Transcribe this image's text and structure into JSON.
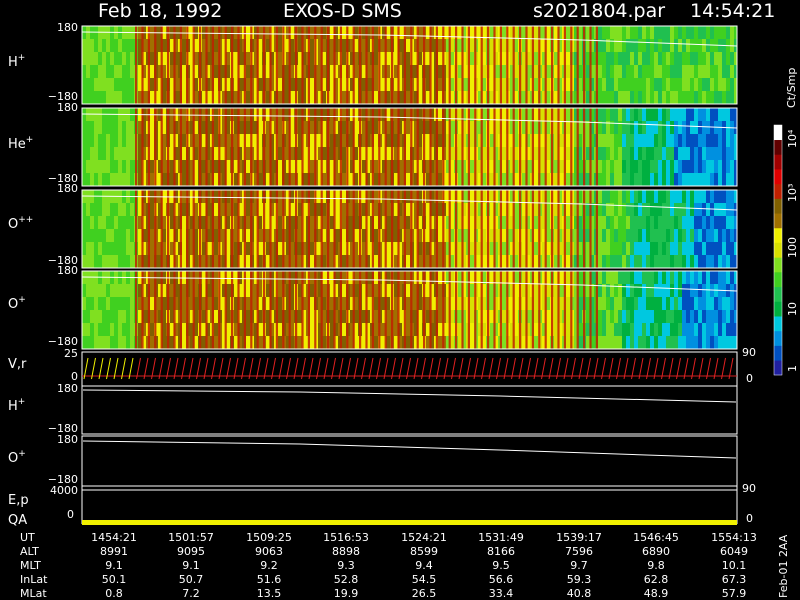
{
  "header": {
    "date": "Feb 18, 1992",
    "mission": "EXOS-D SMS",
    "file": "s2021804.par",
    "time": "14:54:21"
  },
  "side_label": "Feb-01 2AA",
  "colorbar": {
    "unit": "Ct/Smp",
    "tick_labels": [
      "1",
      "10",
      "100",
      "10³",
      "10⁴"
    ],
    "colors": [
      "#2020a0",
      "#0050c0",
      "#0090e0",
      "#00c8e0",
      "#00b040",
      "#20c050",
      "#40d020",
      "#80e020",
      "#d8e000",
      "#f0f000",
      "#a07000",
      "#806000",
      "#c02000",
      "#e00000",
      "#a00000",
      "#600000",
      "#ffffff"
    ]
  },
  "chart_data": [
    {
      "type": "heatmap",
      "panel": "H+",
      "label_base": "H",
      "label_sup": "+",
      "ylim": [
        -180,
        180
      ],
      "tick_labels": [
        "180",
        "−180"
      ]
    },
    {
      "type": "heatmap",
      "panel": "He+",
      "label_base": "He",
      "label_sup": "+",
      "ylim": [
        -180,
        180
      ],
      "tick_labels": [
        "180",
        "−180"
      ]
    },
    {
      "type": "heatmap",
      "panel": "O++",
      "label_base": "O",
      "label_sup": "++",
      "ylim": [
        -180,
        180
      ],
      "tick_labels": [
        "180",
        "−180"
      ]
    },
    {
      "type": "heatmap",
      "panel": "O+",
      "label_base": "O",
      "label_sup": "+",
      "ylim": [
        -180,
        180
      ],
      "tick_labels": [
        "180",
        "−180"
      ]
    },
    {
      "type": "line",
      "panel": "V,r",
      "label": "V,r",
      "ylim_left": [
        0,
        25
      ],
      "tick_labels_left": [
        "25",
        "0"
      ],
      "ylim_right": [
        0,
        90
      ],
      "tick_labels_right": [
        "90",
        "0"
      ]
    },
    {
      "type": "line",
      "panel": "H+ angle",
      "label_base": "H",
      "label_sup": "+",
      "ylim": [
        -180,
        180
      ],
      "tick_labels": [
        "180",
        "−180"
      ]
    },
    {
      "type": "line",
      "panel": "O+ angle",
      "label_base": "O",
      "label_sup": "+",
      "ylim": [
        -180,
        180
      ],
      "tick_labels": [
        "180",
        "−180"
      ]
    },
    {
      "type": "line",
      "panel": "E,p",
      "label": "E,p",
      "tick_left": "4000",
      "tick_right": "90"
    },
    {
      "type": "line",
      "panel": "QA",
      "label": "QA",
      "tick_left": "0",
      "tick_right": "0"
    }
  ],
  "table": {
    "rows": [
      {
        "label": "UT",
        "values": [
          "1454:21",
          "1501:57",
          "1509:25",
          "1516:53",
          "1524:21",
          "1531:49",
          "1539:17",
          "1546:45",
          "1554:13"
        ]
      },
      {
        "label": "ALT",
        "values": [
          "8991",
          "9095",
          "9063",
          "8898",
          "8599",
          "8166",
          "7596",
          "6890",
          "6049"
        ]
      },
      {
        "label": "MLT",
        "values": [
          "9.1",
          "9.1",
          "9.2",
          "9.3",
          "9.4",
          "9.5",
          "9.7",
          "9.8",
          "10.1"
        ]
      },
      {
        "label": "InLat",
        "values": [
          "50.1",
          "50.7",
          "51.6",
          "52.8",
          "54.5",
          "56.6",
          "59.3",
          "62.8",
          "67.3"
        ]
      },
      {
        "label": "MLat",
        "values": [
          "0.8",
          "7.2",
          "13.5",
          "19.9",
          "26.5",
          "33.4",
          "40.8",
          "48.9",
          "57.9"
        ]
      }
    ]
  }
}
